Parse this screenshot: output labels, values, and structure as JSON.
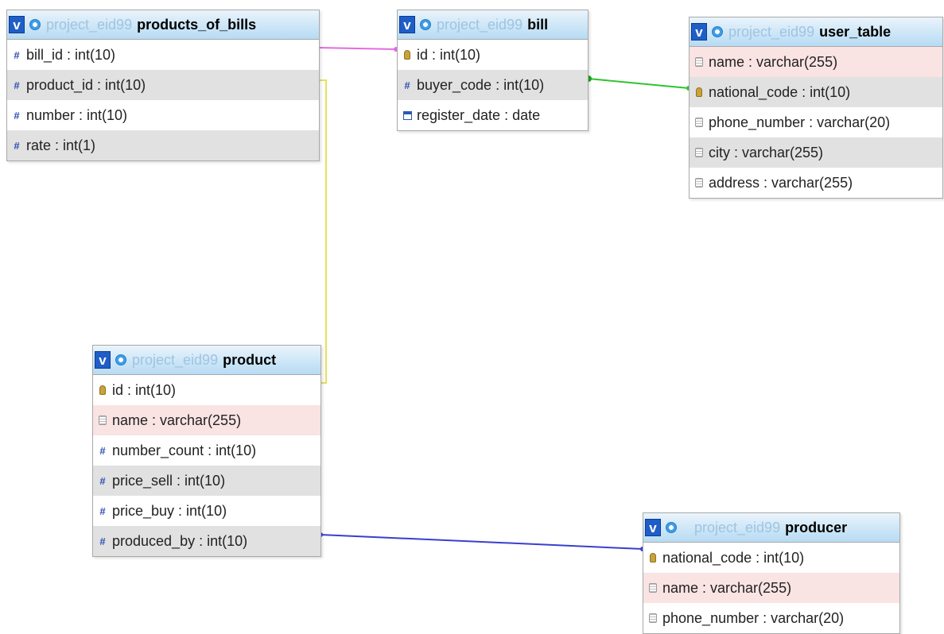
{
  "tables": {
    "products_of_bills": {
      "db": "project_eid99",
      "name": "products_of_bills",
      "rows": [
        {
          "text": "bill_id : int(10)",
          "icon": "number-icon"
        },
        {
          "text": "product_id : int(10)",
          "icon": "number-icon"
        },
        {
          "text": "number : int(10)",
          "icon": "number-icon"
        },
        {
          "text": "rate : int(1)",
          "icon": "number-icon"
        }
      ]
    },
    "bill": {
      "db": "project_eid99",
      "name": "bill",
      "rows": [
        {
          "text": "id : int(10)",
          "icon": "key-icon"
        },
        {
          "text": "buyer_code : int(10)",
          "icon": "number-icon"
        },
        {
          "text": "register_date : date",
          "icon": "date-icon"
        }
      ]
    },
    "user_table": {
      "db": "project_eid99",
      "name": "user_table",
      "rows": [
        {
          "text": "name : varchar(255)",
          "icon": "string-icon"
        },
        {
          "text": "national_code : int(10)",
          "icon": "key-icon"
        },
        {
          "text": "phone_number : varchar(20)",
          "icon": "string-icon"
        },
        {
          "text": "city : varchar(255)",
          "icon": "string-icon"
        },
        {
          "text": "address : varchar(255)",
          "icon": "string-icon"
        }
      ]
    },
    "product": {
      "db": "project_eid99",
      "name": "product",
      "rows": [
        {
          "text": "id : int(10)",
          "icon": "key-icon"
        },
        {
          "text": "name : varchar(255)",
          "icon": "string-icon"
        },
        {
          "text": "number_count : int(10)",
          "icon": "number-icon"
        },
        {
          "text": "price_sell : int(10)",
          "icon": "number-icon"
        },
        {
          "text": "price_buy : int(10)",
          "icon": "number-icon"
        },
        {
          "text": "produced_by : int(10)",
          "icon": "number-icon"
        }
      ]
    },
    "producer": {
      "db": "project_eid99",
      "name": "producer",
      "rows": [
        {
          "text": "national_code : int(10)",
          "icon": "key-icon"
        },
        {
          "text": "name : varchar(255)",
          "icon": "string-icon"
        },
        {
          "text": "phone_number : varchar(20)",
          "icon": "string-icon"
        }
      ]
    }
  },
  "relation_colors": {
    "bill_link": "#e46be0",
    "user_link": "#2fc42f",
    "product_link": "#e6e05a",
    "producer_link": "#3a3fce"
  }
}
